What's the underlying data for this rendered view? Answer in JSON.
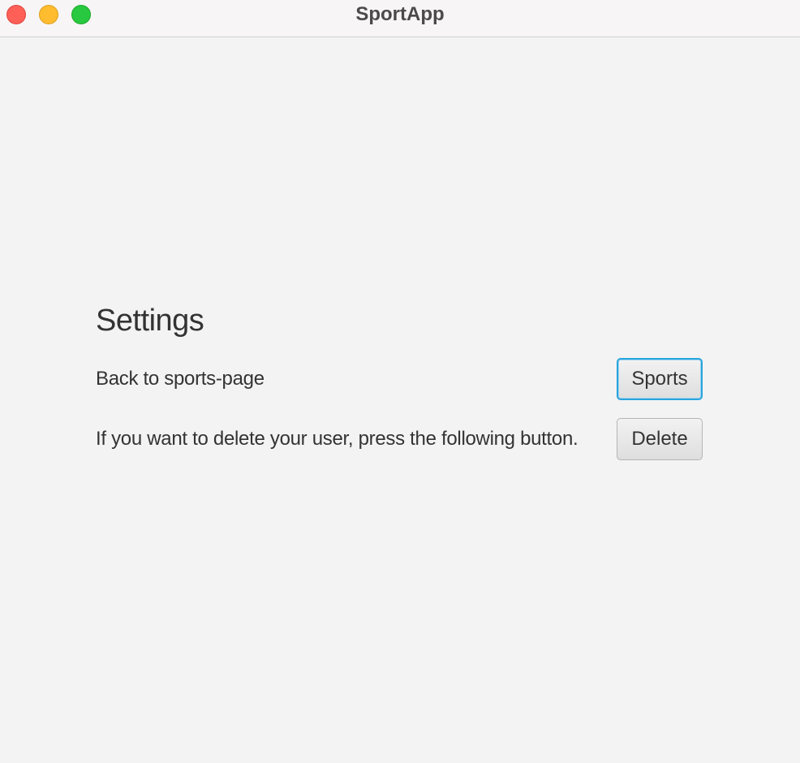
{
  "window": {
    "title": "SportApp"
  },
  "settings": {
    "heading": "Settings",
    "back_label": "Back to sports-page",
    "back_button": "Sports",
    "delete_label": "If you want to delete your user, press the following button.",
    "delete_button": "Delete"
  },
  "colors": {
    "focus_ring": "#2aa4dd",
    "close": "#fe5f57",
    "minimize": "#febc2e",
    "zoom": "#28c840"
  }
}
